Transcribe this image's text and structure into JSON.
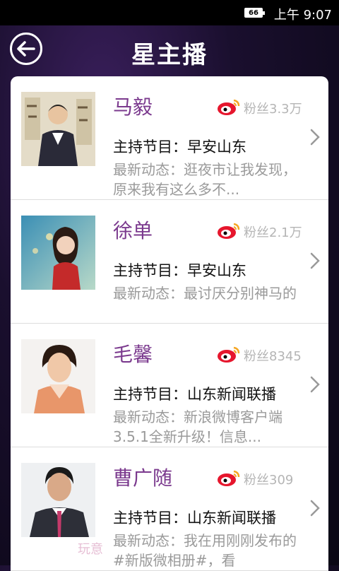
{
  "status_bar": {
    "battery": "66",
    "time": "上午 9:07"
  },
  "header": {
    "title": "星主播"
  },
  "hosts": [
    {
      "name": "马毅",
      "fans": "粉丝3.3万",
      "program": "主持节目：早安山东",
      "latest": "最新动态：逛夜市让我发现，原来我有这么多不..."
    },
    {
      "name": "徐单",
      "fans": "粉丝2.1万",
      "program": "主持节目：早安山东",
      "latest": "最新动态：最讨厌分别神马的"
    },
    {
      "name": "毛馨",
      "fans": "粉丝8345",
      "program": "主持节目：山东新闻联播",
      "latest": "最新动态：新浪微博客户端3.5.1全新升级！信息..."
    },
    {
      "name": "曹广随",
      "fans": "粉丝309",
      "program": "主持节目：山东新闻联播",
      "latest": "最新动态：我在用刚刚发布的#新版微相册#，看"
    }
  ],
  "watermark": "玩意"
}
